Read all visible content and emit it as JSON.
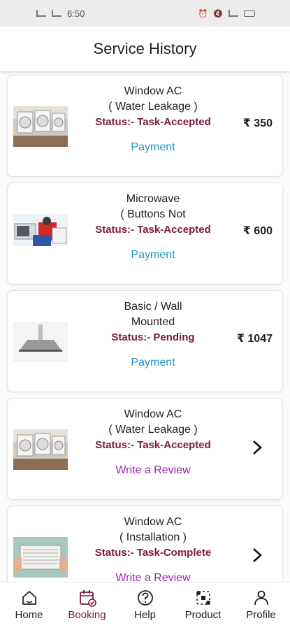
{
  "status_bar": {
    "time": "6:50"
  },
  "header": {
    "title": "Service History"
  },
  "services": [
    {
      "title_line1": "Window AC",
      "title_line2": "( Water Leakage )",
      "status": "Status:- Task-Accepted",
      "action": "Payment",
      "price": "₹ 350",
      "thumbnail": "window-ac-image"
    },
    {
      "title_line1": "Microwave",
      "title_line2": "( Buttons Not",
      "status": "Status:- Task-Accepted",
      "action": "Payment",
      "price": "₹ 600",
      "thumbnail": "microwave-image"
    },
    {
      "title_line1": "Basic / Wall",
      "title_line2": "Mounted",
      "status": "Status:- Pending",
      "action": "Payment",
      "price": "₹ 1047",
      "thumbnail": "chimney-image"
    },
    {
      "title_line1": "Window AC",
      "title_line2": "( Water Leakage )",
      "status": "Status:- Task-Accepted",
      "action": "Write a Review",
      "thumbnail": "window-ac-image"
    },
    {
      "title_line1": "Window AC",
      "title_line2": "( Installation )",
      "status": "Status:- Task-Complete",
      "action": "Write a Review",
      "thumbnail": "window-ac-install-image"
    }
  ],
  "tabbar": {
    "active": "Booking",
    "tabs": [
      {
        "label": "Home",
        "icon": "home-icon"
      },
      {
        "label": "Booking",
        "icon": "calendar-check-icon"
      },
      {
        "label": "Help",
        "icon": "help-icon"
      },
      {
        "label": "Product",
        "icon": "product-icon"
      },
      {
        "label": "Profile",
        "icon": "person-icon"
      }
    ]
  },
  "colors": {
    "status": "#7a1a3c",
    "payment": "#2196c9",
    "review": "#9b27af",
    "active_tab": "#7a1a3c"
  }
}
